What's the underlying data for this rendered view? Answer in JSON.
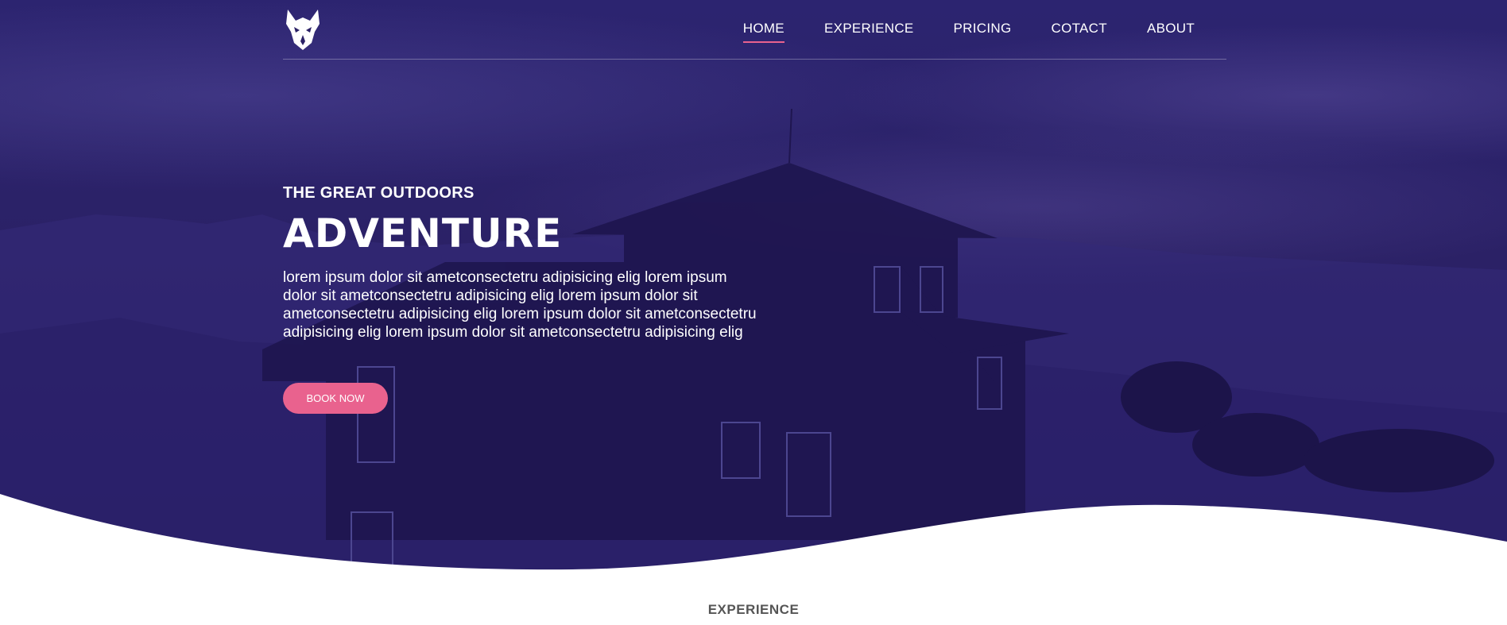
{
  "header": {
    "logo": "wolf-logo",
    "nav": [
      {
        "label": "HOME",
        "active": true
      },
      {
        "label": "EXPERIENCE"
      },
      {
        "label": "PRICING"
      },
      {
        "label": "COTACT"
      },
      {
        "label": "ABOUT"
      }
    ]
  },
  "hero": {
    "eyebrow": "THE GREAT OUTDOORS",
    "title": "ADVENTURE",
    "description": "lorem ipsum dolor sit ametconsectetru adipisicing elig lorem ipsum dolor sit ametconsectetru adipisicing elig lorem ipsum dolor sit ametconsectetru adipisicing elig lorem ipsum dolor sit ametconsectetru adipisicing elig lorem ipsum dolor sit ametconsectetru adipisicing elig",
    "cta_label": "BOOK NOW"
  },
  "experience": {
    "title": "EXPERIENCE"
  },
  "colors": {
    "overlay": "#2b2166",
    "accent": "#e9628e",
    "text": "#ffffff",
    "section_title": "#555555"
  }
}
